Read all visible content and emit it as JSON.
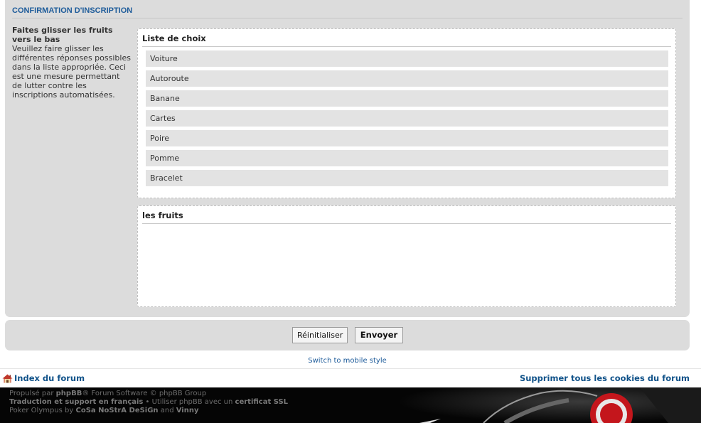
{
  "panel": {
    "title": "CONFIRMATION D'INSCRIPTION"
  },
  "instructions": {
    "title": "Faites glisser les fruits vers le bas",
    "body": "Veuillez faire glisser les différentes réponses possibles dans la liste appropriée. Ceci est une mesure permettant de lutter contre les inscriptions automatisées."
  },
  "choices_box": {
    "title": "Liste de choix",
    "items": [
      "Voiture",
      "Autoroute",
      "Banane",
      "Cartes",
      "Poire",
      "Pomme",
      "Bracelet"
    ]
  },
  "fruits_box": {
    "title": "les fruits",
    "items": []
  },
  "buttons": {
    "reset": "Réinitialiser",
    "submit": "Envoyer"
  },
  "mobile_link": "Switch to mobile style",
  "navbar": {
    "index": "Index du forum",
    "cookies": "Supprimer tous les cookies du forum"
  },
  "footer": {
    "line1_pre": "Propulsé par ",
    "line1_link": "phpBB",
    "line1_post": "® Forum Software © phpBB Group",
    "line2_link": "Traduction et support en français",
    "line2_sep": " • Utiliser phpBB avec un ",
    "line2_link2": "certificat SSL",
    "line3_pre": "Poker Olympus by ",
    "line3_link": "CoSa NoStrA DeSiGn",
    "line3_mid": " and ",
    "line3_link2": "Vinny"
  },
  "colors": {
    "panel_bg": "#dcdcdc",
    "title_blue": "#1d5b9a",
    "link_blue": "#105289",
    "footer_bg": "#050505"
  }
}
